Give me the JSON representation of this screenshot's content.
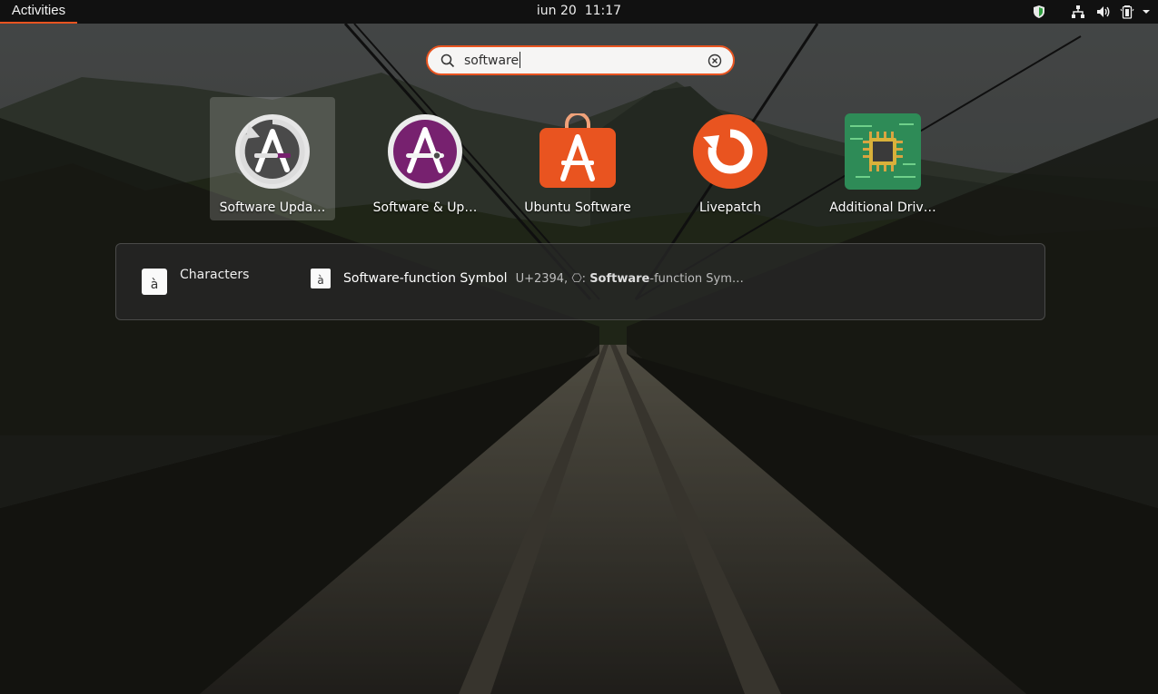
{
  "topbar": {
    "activities_label": "Activities",
    "date": "iun 20",
    "time": "11:17",
    "tray_icons": [
      "security-shield-icon",
      "network-icon",
      "volume-icon",
      "battery-icon",
      "system-menu-chevron-icon"
    ]
  },
  "search": {
    "value": "software",
    "icons": [
      "search-icon",
      "clear-icon"
    ]
  },
  "apps": [
    {
      "label": "Software Upda…",
      "icon": "software-updater-icon",
      "selected": true
    },
    {
      "label": "Software & Up…",
      "icon": "software-properties-icon",
      "selected": false
    },
    {
      "label": "Ubuntu Software",
      "icon": "ubuntu-software-icon",
      "selected": false
    },
    {
      "label": "Livepatch",
      "icon": "livepatch-icon",
      "selected": false
    },
    {
      "label": "Additional Driv…",
      "icon": "additional-drivers-icon",
      "selected": false
    }
  ],
  "search_provider": {
    "name": "Characters",
    "icon_glyph": "à",
    "result": {
      "icon_glyph": "à",
      "title": "Software-function Symbol",
      "desc_prefix": "U+2394, ⎔: ",
      "desc_match": "Software",
      "desc_suffix": "-function Sym…"
    }
  },
  "colors": {
    "accent": "#e95420",
    "topbar": "#111111",
    "ubuntu_purple": "#77216f"
  }
}
